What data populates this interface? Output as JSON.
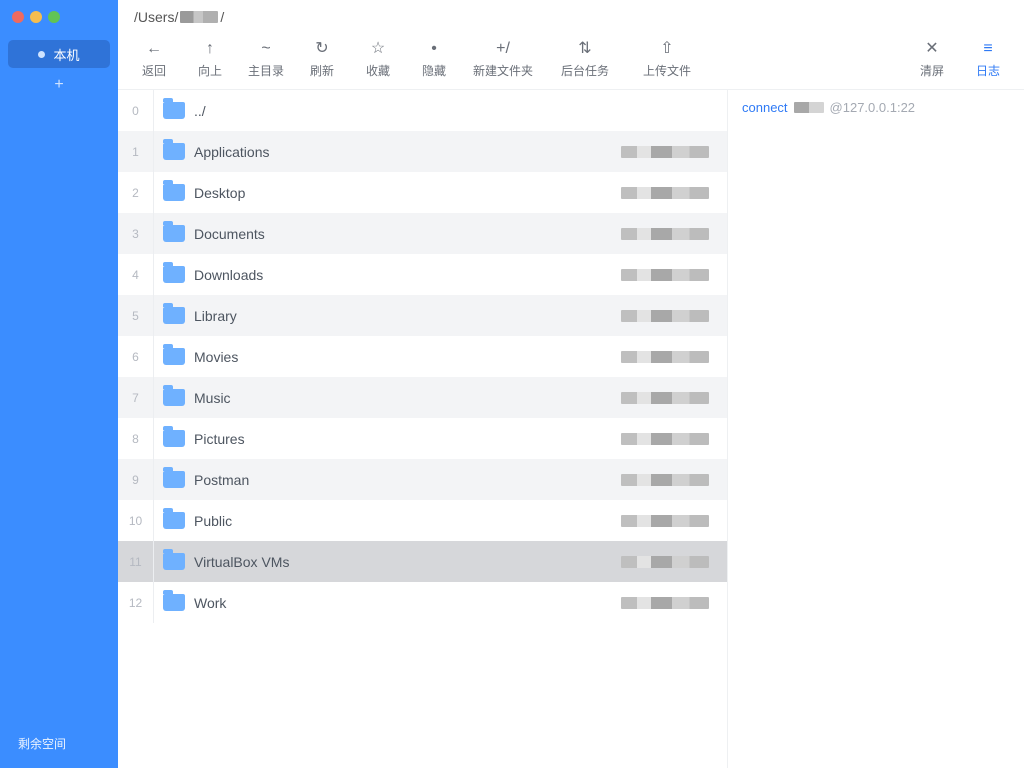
{
  "sidebar": {
    "host_label": "本机",
    "free_space_label": "剩余空间"
  },
  "path": {
    "prefix": "/Users/",
    "suffix": "/"
  },
  "toolbar": {
    "back": {
      "label": "返回",
      "icon": "←"
    },
    "up": {
      "label": "向上",
      "icon": "↑"
    },
    "home": {
      "label": "主目录",
      "icon": "~"
    },
    "refresh": {
      "label": "刷新",
      "icon": "↻"
    },
    "favorite": {
      "label": "收藏",
      "icon": "☆"
    },
    "hidden": {
      "label": "隐藏",
      "icon": "•"
    },
    "newfolder": {
      "label": "新建文件夹",
      "icon": "+/"
    },
    "tasks": {
      "label": "后台任务",
      "icon": "⇅"
    },
    "upload": {
      "label": "上传文件",
      "icon": "⇧"
    },
    "clear": {
      "label": "清屏",
      "icon": "✕"
    },
    "log": {
      "label": "日志",
      "icon": "≡"
    }
  },
  "files": {
    "items": [
      {
        "idx": "0",
        "name": "../"
      },
      {
        "idx": "1",
        "name": "Applications"
      },
      {
        "idx": "2",
        "name": "Desktop"
      },
      {
        "idx": "3",
        "name": "Documents"
      },
      {
        "idx": "4",
        "name": "Downloads"
      },
      {
        "idx": "5",
        "name": "Library"
      },
      {
        "idx": "6",
        "name": "Movies"
      },
      {
        "idx": "7",
        "name": "Music"
      },
      {
        "idx": "8",
        "name": "Pictures"
      },
      {
        "idx": "9",
        "name": "Postman"
      },
      {
        "idx": "10",
        "name": "Public"
      },
      {
        "idx": "11",
        "name": "VirtualBox VMs"
      },
      {
        "idx": "12",
        "name": "Work"
      }
    ],
    "selected_index": 11
  },
  "log": {
    "connect_label": "connect",
    "tail": "@127.0.0.1:22"
  }
}
